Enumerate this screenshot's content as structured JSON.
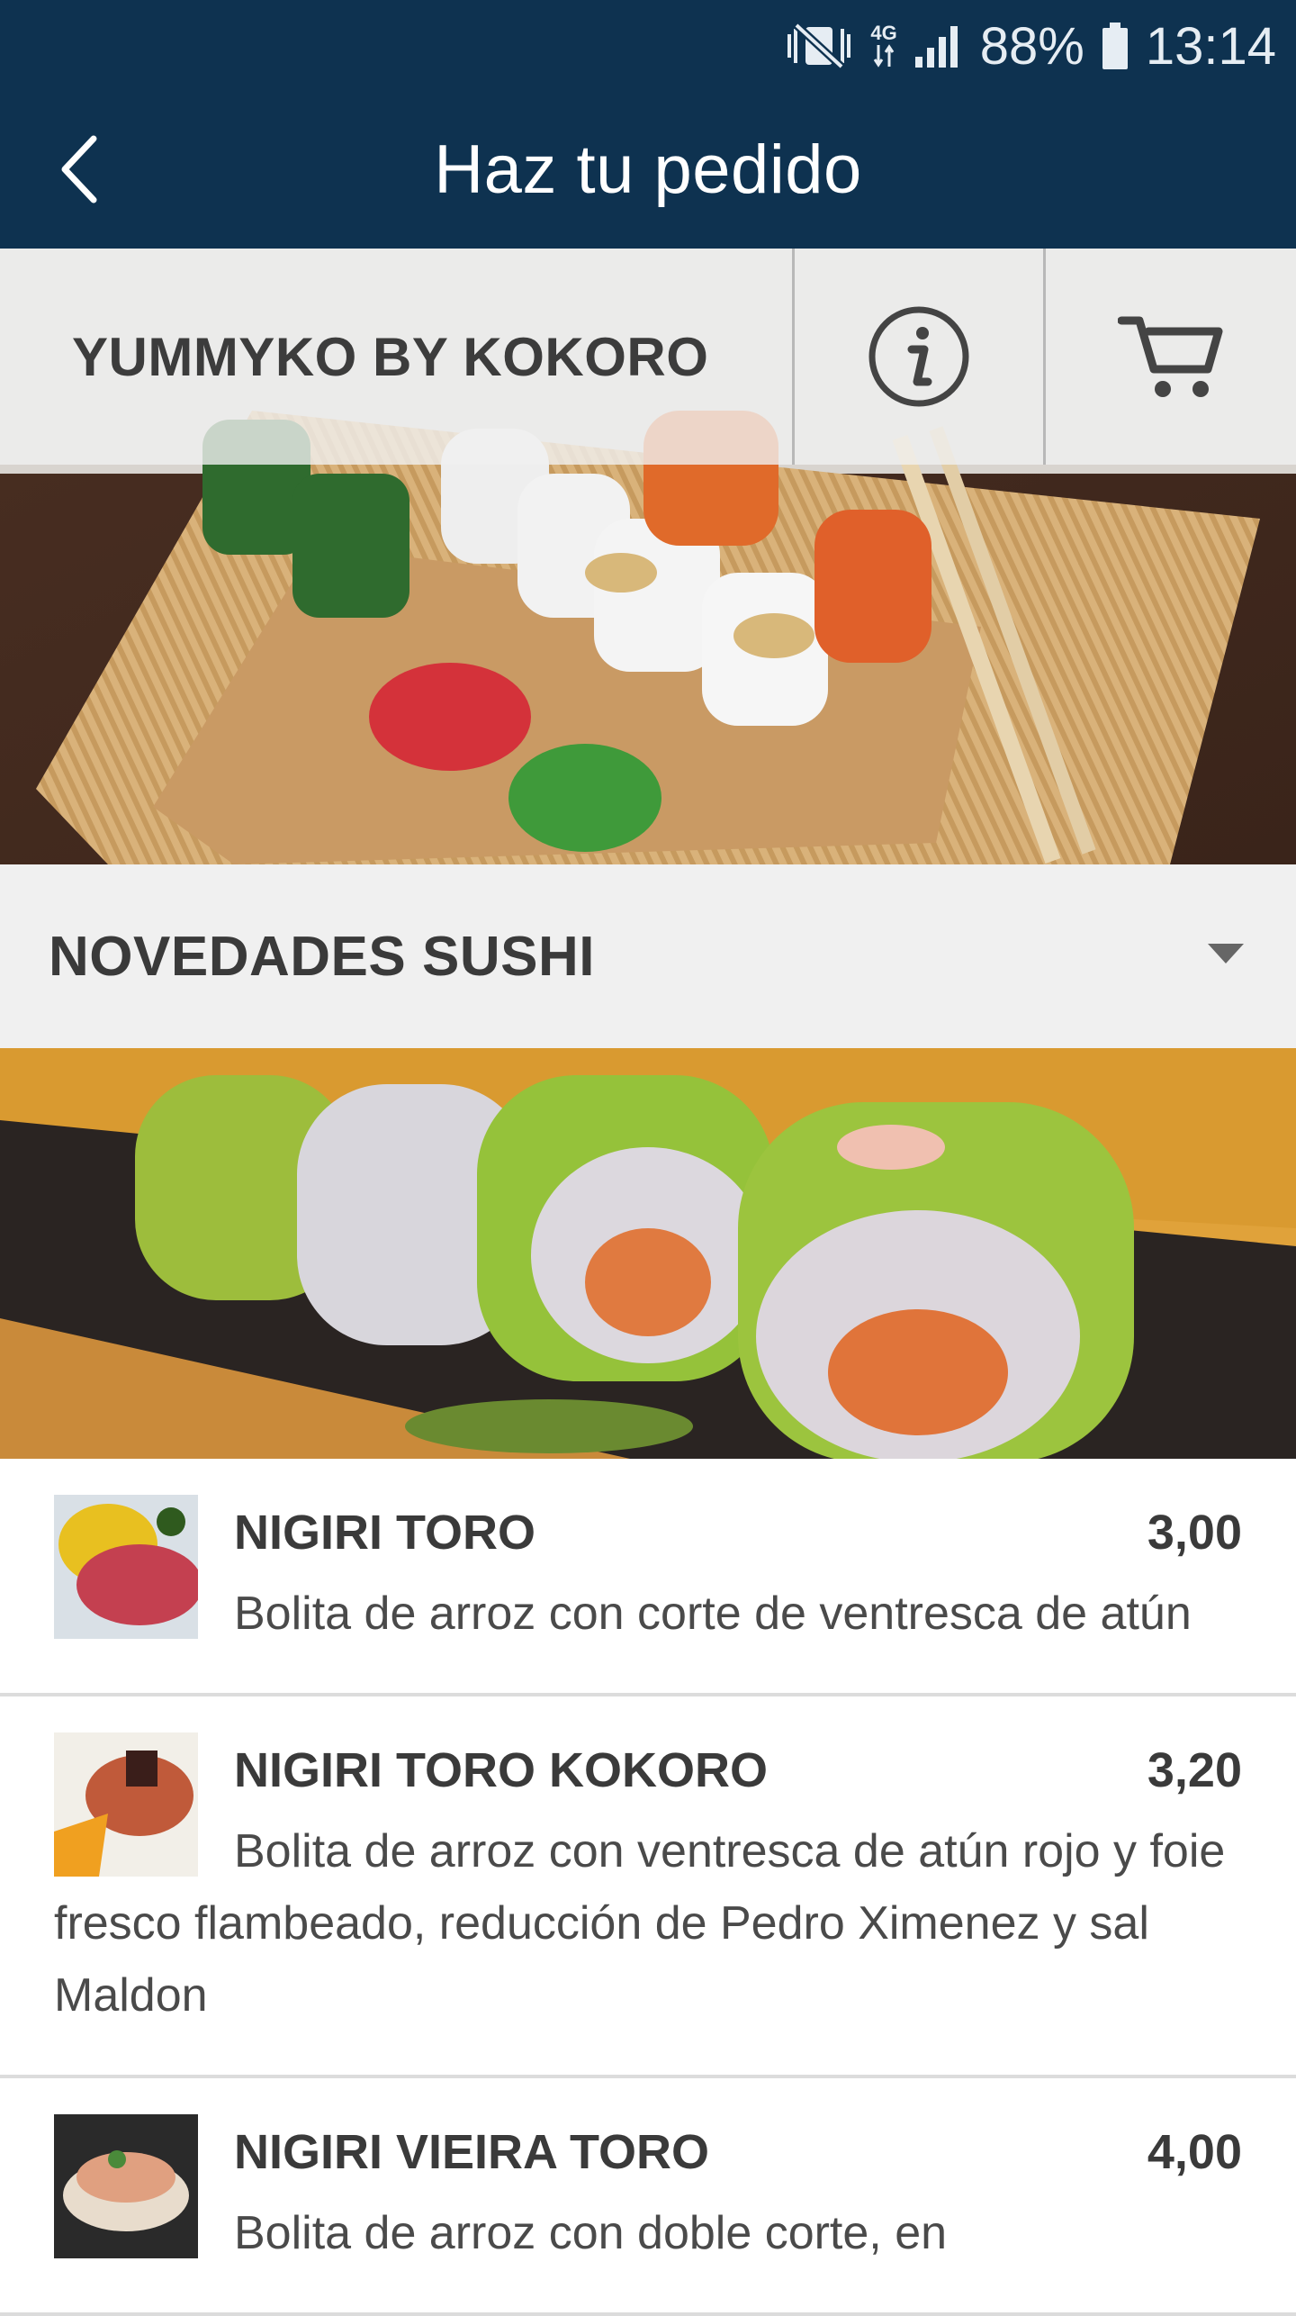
{
  "status_bar": {
    "battery": "88%",
    "time": "13:14",
    "network": "4G"
  },
  "app_bar": {
    "title": "Haz tu pedido",
    "back_icon": "chevron-left-icon"
  },
  "restaurant": {
    "name": "YUMMYKO BY KOKORO",
    "info_icon": "info-icon",
    "cart_icon": "cart-icon"
  },
  "category": {
    "selected": "NOVEDADES SUSHI",
    "caret_icon": "caret-down-icon"
  },
  "items": [
    {
      "name": "NIGIRI TORO",
      "price": "3,00",
      "description": "Bolita de arroz con corte de ventresca de atún"
    },
    {
      "name": "NIGIRI TORO KOKORO",
      "price": "3,20",
      "description": "Bolita de arroz con ventresca de atún rojo y foie fresco flambeado, reducción de Pedro Ximenez y sal Maldon"
    },
    {
      "name": "NIGIRI VIEIRA TORO",
      "price": "4,00",
      "description": "Bolita de arroz con doble corte, en"
    }
  ],
  "colors": {
    "primary": "#0e3250",
    "category_bg": "#f0f0f0",
    "text_dark": "#3a3a3a"
  }
}
